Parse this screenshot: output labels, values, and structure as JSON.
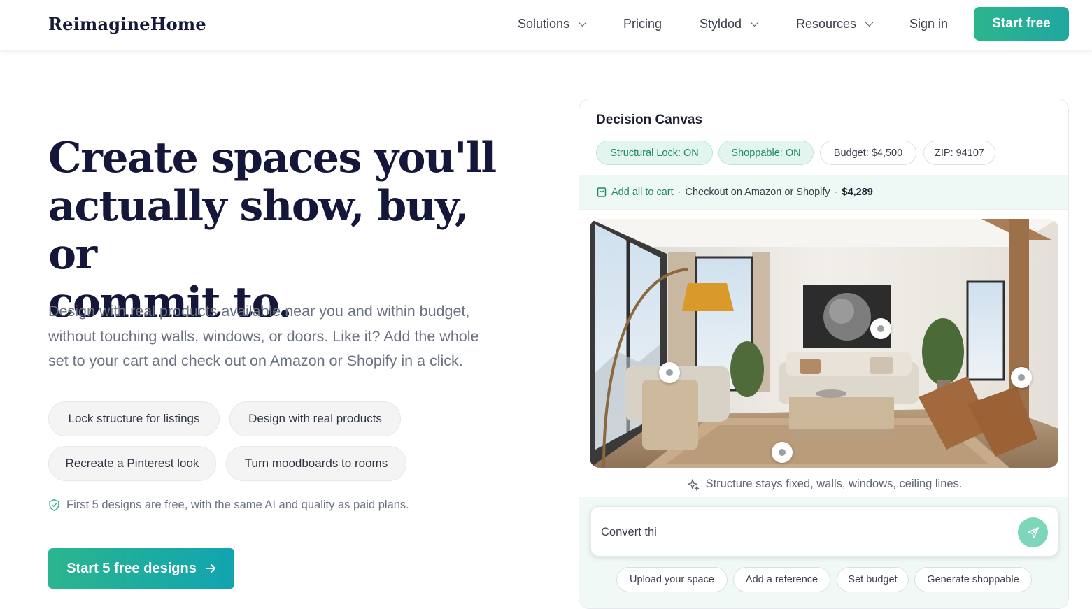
{
  "nav": {
    "logo": "ReimagineHome",
    "items": [
      {
        "label": "Solutions",
        "dropdown": true
      },
      {
        "label": "Pricing",
        "dropdown": false
      },
      {
        "label": "Styldod",
        "dropdown": true
      },
      {
        "label": "Resources",
        "dropdown": true
      }
    ],
    "signin": "Sign in",
    "start": "Start free"
  },
  "hero": {
    "title_l1": "Create spaces you'll",
    "title_l2": "actually show, buy, or",
    "title_l3": "commit to.",
    "sub_l1": "Design with real products available near you and within budget,",
    "sub_l2": "without touching walls, windows, or doors. Like it? Add the whole",
    "sub_l3": "set to your cart and check out on Amazon or Shopify in a click.",
    "chips": [
      "Lock structure for listings",
      "Design with real products",
      "Recreate a Pinterest look",
      "Turn moodboards to rooms"
    ],
    "free_note": "First 5 designs are free, with the same AI and quality as paid plans.",
    "cta": "Start 5 free designs",
    "cta_icon": "arrow-right-icon"
  },
  "canvas": {
    "title": "Decision Canvas",
    "pills": [
      "Structural Lock: ON",
      "Shoppable: ON",
      "Budget: $4,500",
      "ZIP: 94107"
    ],
    "cart_action": "Add all to cart",
    "cart_sep": "·",
    "checkout_text": "Checkout on Amazon or Shopify",
    "total": "$4,289",
    "structure_note": "Structure stays fixed, walls, windows, ceiling lines.",
    "prompt_value": "Convert thi",
    "quick_actions": [
      "Upload your space",
      "Add a reference",
      "Set budget",
      "Generate shoppable"
    ]
  },
  "colors": {
    "brand_green": "#2cb58d",
    "brand_teal": "#11a4b1",
    "title_navy": "#14173a",
    "pill_on_bg": "#e2f5ee",
    "pill_on_text": "#1f8a62"
  }
}
